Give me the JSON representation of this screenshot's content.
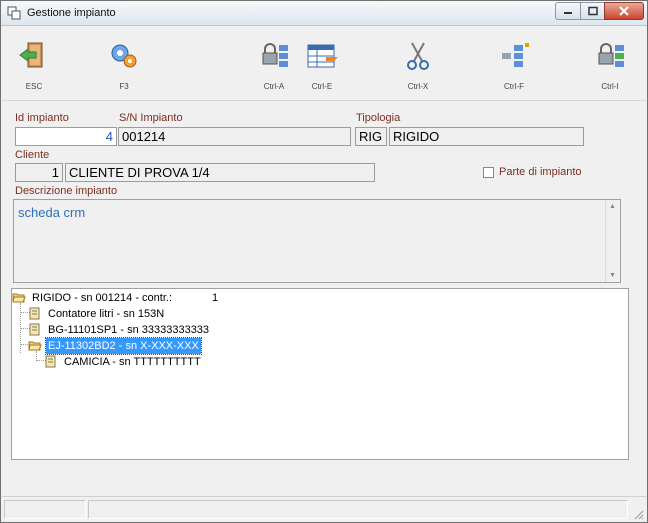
{
  "window": {
    "title": "Gestione impianto"
  },
  "toolbar": {
    "buttons": [
      {
        "label": "ESC",
        "icon": "exit-door-icon"
      },
      {
        "label": "F3",
        "icon": "gears-icon"
      },
      {
        "label": "Ctrl-A",
        "icon": "lock-list-icon"
      },
      {
        "label": "Ctrl-E",
        "icon": "edit-table-icon"
      },
      {
        "label": "Ctrl-X",
        "icon": "scissors-icon"
      },
      {
        "label": "Ctrl-F",
        "icon": "find-list-icon"
      },
      {
        "label": "Ctrl-I",
        "icon": "lock-insert-icon"
      }
    ]
  },
  "form": {
    "id_label": "Id impianto",
    "id_value": "4",
    "sn_label": "S/N Impianto",
    "sn_value": "001214",
    "tipologia_label": "Tipologia",
    "tipologia_code": "RIG",
    "tipologia_desc": "RIGIDO",
    "cliente_label": "Cliente",
    "cliente_code": "1",
    "cliente_name": "CLIENTE DI PROVA 1/4",
    "parte_label": "Parte di impianto",
    "parte_checked": false,
    "descrizione_label": "Descrizione impianto",
    "descrizione_value": "scheda crm"
  },
  "tree": {
    "root": {
      "label": "RIGIDO - sn 001214 - contr.:",
      "count": "1"
    },
    "items": [
      {
        "label": "Contatore litri - sn 153N"
      },
      {
        "label": "BG-11101SP1 - sn 33333333333"
      },
      {
        "label": "EJ-11302BD2 - sn X-XXX-XXX",
        "selected": true
      },
      {
        "label": "CAMICIA - sn TTTTTTTTTT"
      }
    ]
  },
  "colors": {
    "label": "#7a2f1f",
    "selection": "#3399ff",
    "description_text": "#2b6fbd"
  }
}
